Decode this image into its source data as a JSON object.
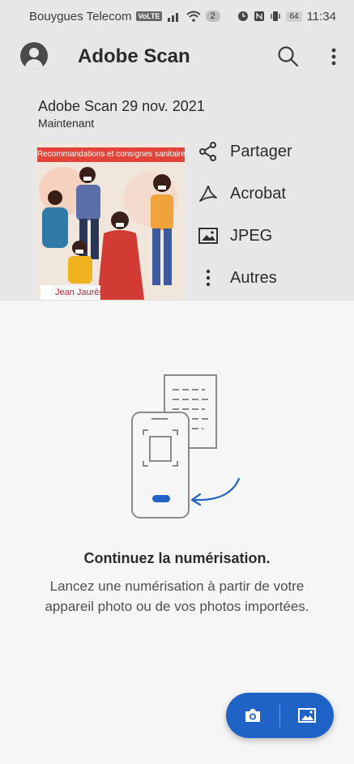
{
  "status_bar": {
    "carrier": "Bouygues Telecom",
    "volte": "VoLTE",
    "notif_count": "2",
    "battery": "64",
    "time": "11:34"
  },
  "app_bar": {
    "title": "Adobe Scan",
    "icons": [
      "account-icon",
      "search-icon",
      "more-vert-icon"
    ]
  },
  "recent_scan": {
    "name": "Adobe Scan 29 nov. 2021",
    "time": "Maintenant",
    "thumbnail": {
      "banner_text": "Recommandations et consignes sanitaires pour",
      "logo_text": "Jean Jaurès"
    },
    "actions": [
      {
        "label": "Partager",
        "icon": "share-icon"
      },
      {
        "label": "Acrobat",
        "icon": "acrobat-icon"
      },
      {
        "label": "JPEG",
        "icon": "image-icon"
      },
      {
        "label": "Autres",
        "icon": "more-vert-icon"
      }
    ]
  },
  "empty_state": {
    "title": "Continuez la numérisation.",
    "body": "Lancez une numérisation à partir de votre appareil photo ou de vos photos importées."
  },
  "fab": {
    "icons": [
      "camera-icon",
      "gallery-icon"
    ]
  },
  "colors": {
    "accent": "#1f63c6",
    "header_bg": "#e7e7e7",
    "sheet_bg": "#f6f6f6",
    "illustration_stroke": "#8a8a8a"
  }
}
